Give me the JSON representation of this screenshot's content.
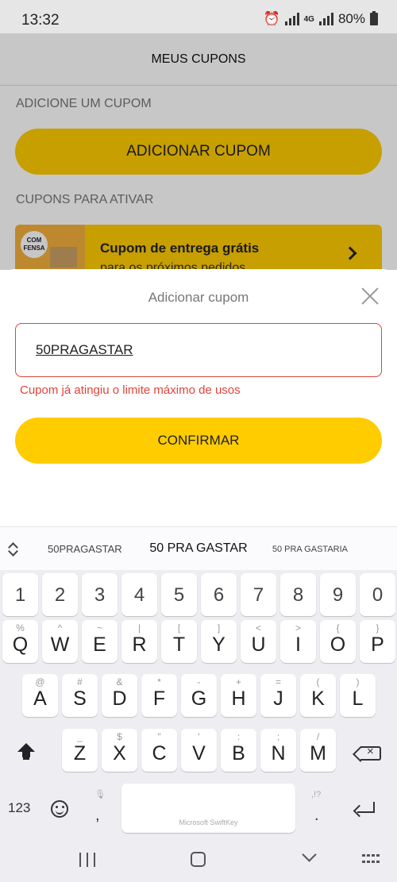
{
  "status_bar": {
    "time": "13:32",
    "network": "4G",
    "battery": "80%"
  },
  "page": {
    "header_title": "MEUS CUPONS",
    "section_add": "ADICIONE UM CUPOM",
    "add_coupon_button": "ADICIONAR CUPOM",
    "section_activate": "CUPONS PARA ATIVAR",
    "coupon_card": {
      "title": "Cupom de entrega grátis",
      "subtitle": "para os próximos pedidos",
      "badge_text": "COM FENSA"
    }
  },
  "sheet": {
    "title": "Adicionar cupom",
    "input_value": "50PRAGASTAR",
    "error": "Cupom já atingiu o limite máximo de usos",
    "confirm_button": "CONFIRMAR"
  },
  "keyboard": {
    "suggestions": [
      "50PRAGASTAR",
      "50 PRA GASTAR",
      "50 PRA GASTARIA"
    ],
    "number_row": [
      "1",
      "2",
      "3",
      "4",
      "5",
      "6",
      "7",
      "8",
      "9",
      "0"
    ],
    "row1": [
      {
        "key": "Q",
        "alt": "%"
      },
      {
        "key": "W",
        "alt": "^"
      },
      {
        "key": "E",
        "alt": "~"
      },
      {
        "key": "R",
        "alt": "|"
      },
      {
        "key": "T",
        "alt": "["
      },
      {
        "key": "Y",
        "alt": "]"
      },
      {
        "key": "U",
        "alt": "<"
      },
      {
        "key": "I",
        "alt": ">"
      },
      {
        "key": "O",
        "alt": "{"
      },
      {
        "key": "P",
        "alt": "}"
      }
    ],
    "row2": [
      {
        "key": "A",
        "alt": "@"
      },
      {
        "key": "S",
        "alt": "#"
      },
      {
        "key": "D",
        "alt": "&"
      },
      {
        "key": "F",
        "alt": "*"
      },
      {
        "key": "G",
        "alt": "-"
      },
      {
        "key": "H",
        "alt": "+"
      },
      {
        "key": "J",
        "alt": "="
      },
      {
        "key": "K",
        "alt": "("
      },
      {
        "key": "L",
        "alt": ")"
      }
    ],
    "row3": [
      {
        "key": "Z",
        "alt": "_"
      },
      {
        "key": "X",
        "alt": "$"
      },
      {
        "key": "C",
        "alt": "\""
      },
      {
        "key": "V",
        "alt": "'"
      },
      {
        "key": "B",
        "alt": ":"
      },
      {
        "key": "N",
        "alt": ";"
      },
      {
        "key": "M",
        "alt": "/"
      }
    ],
    "symbols_label": "123",
    "comma": ",",
    "period": ".",
    "period_hint": ",!?",
    "space_label": "Microsoft SwiftKey"
  }
}
